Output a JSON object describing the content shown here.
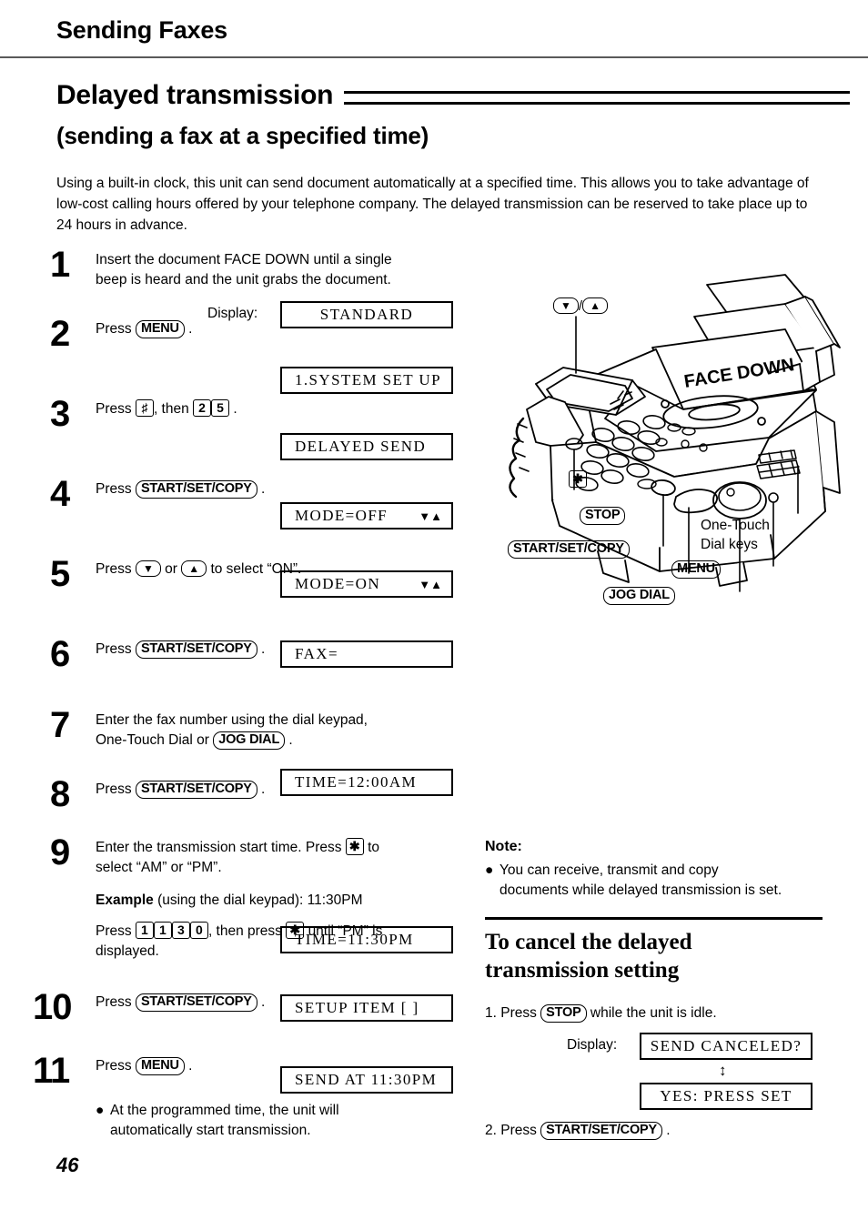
{
  "running_head": "Sending Faxes",
  "heading": {
    "title": "Delayed transmission",
    "subtitle": "(sending a fax at a specified time)"
  },
  "intro": "Using a built-in clock, this unit can send document automatically at a specified time. This allows you to take advantage of low-cost calling hours offered by your telephone company. The delayed transmission can be reserved to take place up to 24 hours in advance.",
  "display_label": "Display:",
  "tokens": {
    "menu": "MENU",
    "start_set_copy": "START/SET/COPY",
    "jog_dial": "JOG DIAL",
    "stop": "STOP",
    "key_hash": "♯",
    "key_star": "✱",
    "key_2": "2",
    "key_5": "5",
    "key_1": "1",
    "key_3": "3",
    "key_0": "0",
    "arrow_down": "▼",
    "arrow_up": "▲",
    "arrows_down_up": "▼▲",
    "updown_sym": "↕"
  },
  "steps": [
    {
      "num": "1",
      "text_line1": "Insert the document FACE DOWN until a single",
      "text_line2": "beep is heard and the unit grabs the document.",
      "display": "STANDARD"
    },
    {
      "num": "2",
      "press": "Press",
      "display": "1.SYSTEM SET UP"
    },
    {
      "num": "3",
      "press": "Press",
      "then": ", then",
      "display": "DELAYED SEND"
    },
    {
      "num": "4",
      "press": "Press",
      "display": "MODE=OFF",
      "arrows": "▼▲"
    },
    {
      "num": "5",
      "press": "Press",
      "mid": "or",
      "tail": "to select “ON”.",
      "display": "MODE=ON",
      "arrows": "▼▲"
    },
    {
      "num": "6",
      "press": "Press",
      "display": "FAX="
    },
    {
      "num": "7",
      "text_line1": "Enter the fax number using the dial keypad,",
      "text_line2_pre": "One-Touch Dial or"
    },
    {
      "num": "8",
      "press": "Press",
      "display": "TIME=12:00AM"
    },
    {
      "num": "9",
      "line1_pre": "Enter the transmission start time. Press",
      "line1_post": "to",
      "line2": "select “AM” or “PM”.",
      "example_label": "Example",
      "example_text": "(using the dial keypad):  11:30PM",
      "press_label": "Press",
      "press_mid": ", then press",
      "press_tail": "until “PM” is",
      "press_line2": "displayed.",
      "display": "TIME=11:30PM"
    },
    {
      "num": "10",
      "press": "Press",
      "display": "SETUP ITEM [  ]"
    },
    {
      "num": "11",
      "press": "Press",
      "display": "SEND AT 11:30PM"
    }
  ],
  "final_bullet": {
    "line1": "At the programmed time, the unit will",
    "line2": "automatically start transmission."
  },
  "page_number": "46",
  "illustration": {
    "face_down_label": "FACE DOWN",
    "callouts": {
      "arrows": "▼ / ▲",
      "star": "✱",
      "stop": "STOP",
      "start_set_copy": "START/SET/COPY",
      "menu": "MENU",
      "jog_dial": "JOG DIAL",
      "one_touch_line1": "One-Touch",
      "one_touch_line2": "Dial keys"
    }
  },
  "note": {
    "heading": "Note:",
    "bullet_line1": "You can receive, transmit and copy",
    "bullet_line2": "documents while delayed transmission is set."
  },
  "cancel": {
    "heading_line1": "To cancel the delayed",
    "heading_line2": "transmission setting",
    "step1_pre": "1.  Press",
    "step1_post": "while the unit is idle.",
    "display_label": "Display:",
    "display1": "SEND CANCELED?",
    "display2": "YES: PRESS SET",
    "step2_pre": "2.  Press"
  }
}
